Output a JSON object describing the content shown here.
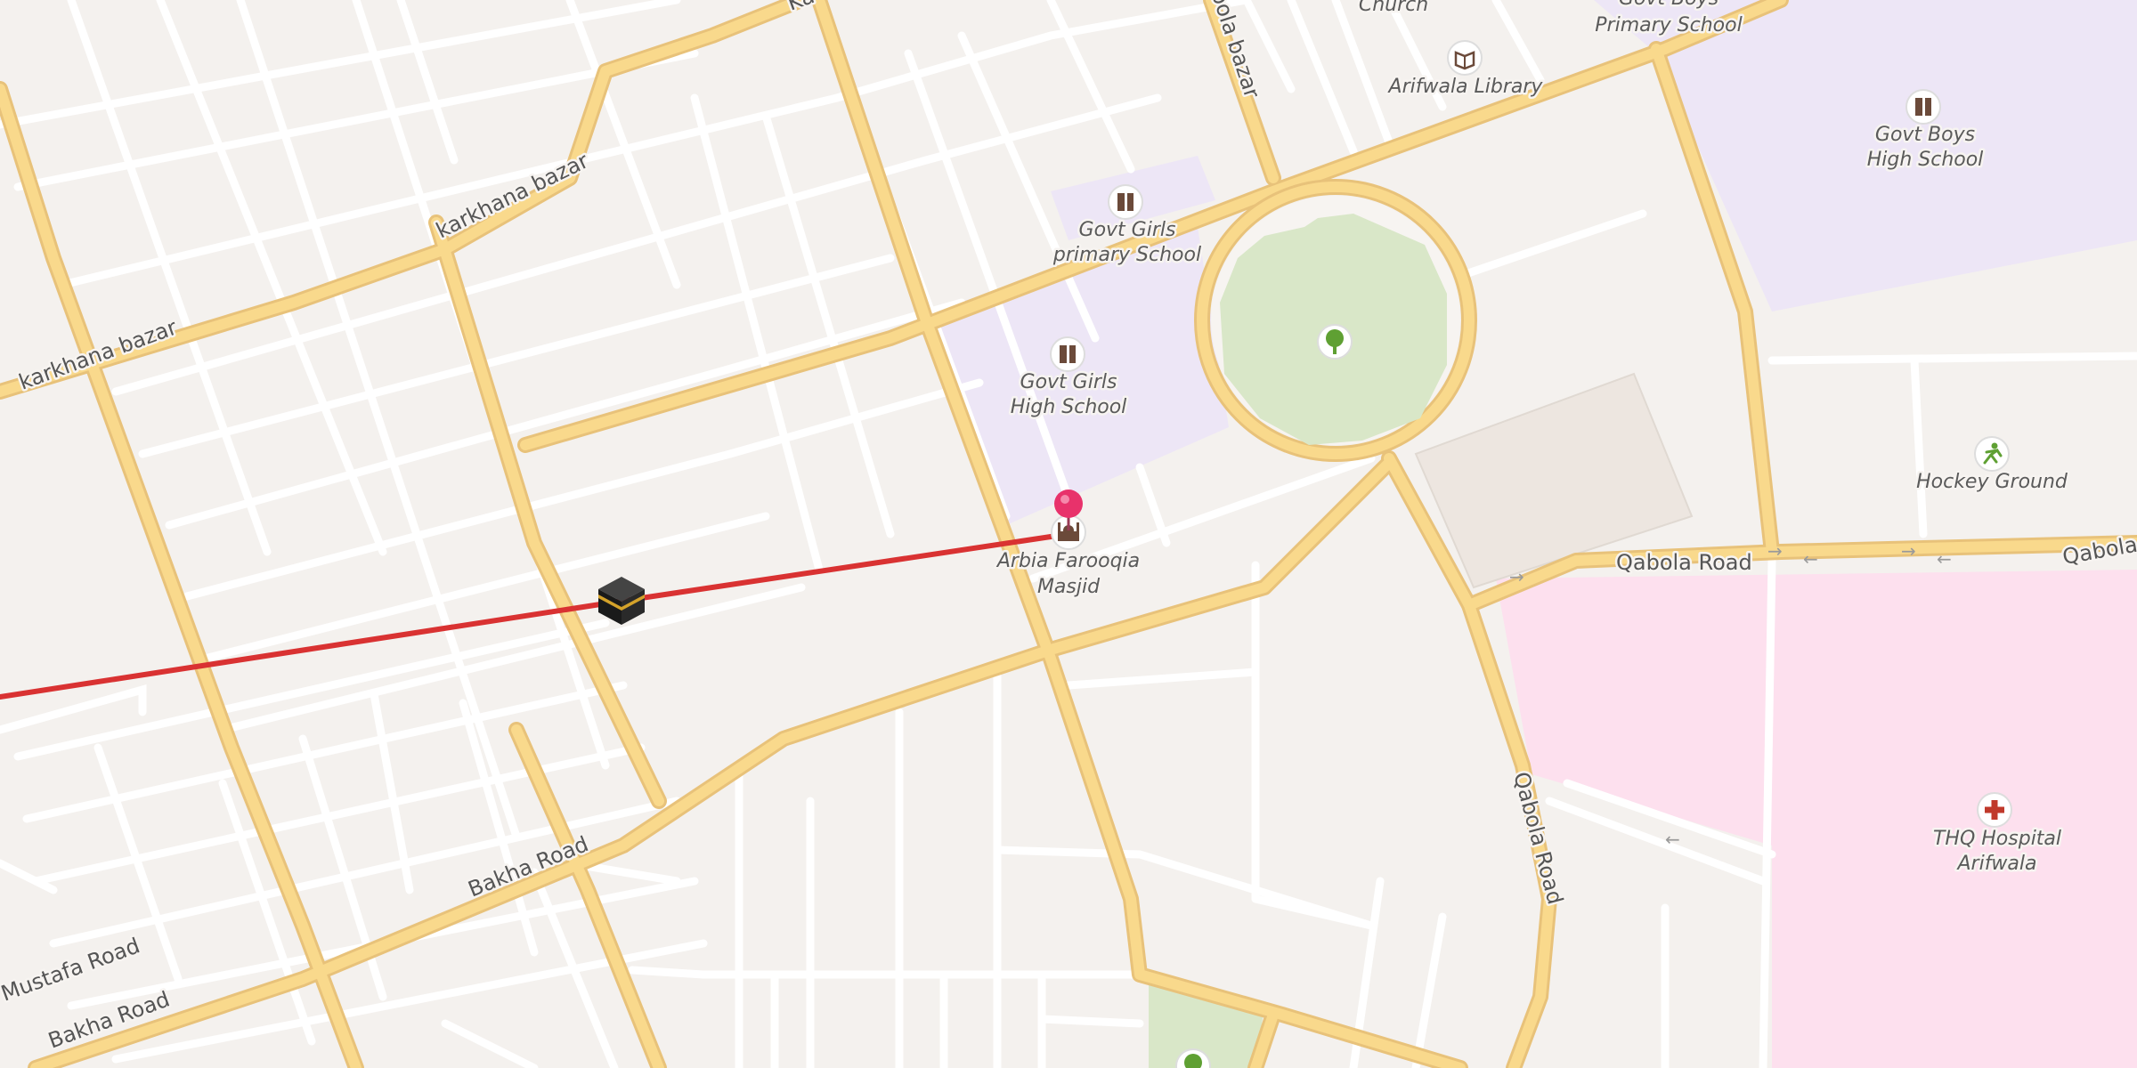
{
  "map": {
    "road_labels": {
      "karkhana_bazar_1": "karkhana bazar",
      "karkhana_bazar_2": "karkhana bazar",
      "qabola_bazar": "Qabola bazar",
      "qabola_road_1": "Qabola Road",
      "qabola_road_2": "Qabola Road",
      "qabola_road_3": "Qabola",
      "bakha_road_1": "Bakha Road",
      "bakha_road_2": "Bakha Road",
      "mustafa_road": "Mustafa Road",
      "karkhana_top": "Ka"
    },
    "pois": {
      "church": "Church",
      "govt_boys_primary": [
        "Govt Boys",
        "Primary School"
      ],
      "arifwala_library": "Arifwala Library",
      "govt_boys_high": [
        "Govt Boys",
        "High School"
      ],
      "govt_girls_primary": [
        "Govt Girls",
        "primary School"
      ],
      "govt_girls_high": [
        "Govt Girls",
        "High School"
      ],
      "arbia_farooqia_masjid": [
        "Arbia Farooqia",
        "Masjid"
      ],
      "hockey_ground": "Hockey Ground",
      "thq_hospital": [
        "THQ Hospital",
        "Arifwala"
      ]
    },
    "icons": {
      "school": "school-icon",
      "library": "library-icon",
      "mosque": "mosque-icon",
      "park": "tree-icon",
      "sports": "sports-icon",
      "hospital": "hospital-icon",
      "pin": "location-pin-icon",
      "kaaba": "kaaba-icon"
    },
    "colors": {
      "background": "#f4f1ee",
      "major_road": "#f9d98c",
      "minor_road": "#ffffff",
      "school_area": "#ede6f6",
      "park": "#d9e7c8",
      "hospital_area": "#fde0ee",
      "route_line": "#d93232",
      "pin": "#e8326b"
    }
  }
}
